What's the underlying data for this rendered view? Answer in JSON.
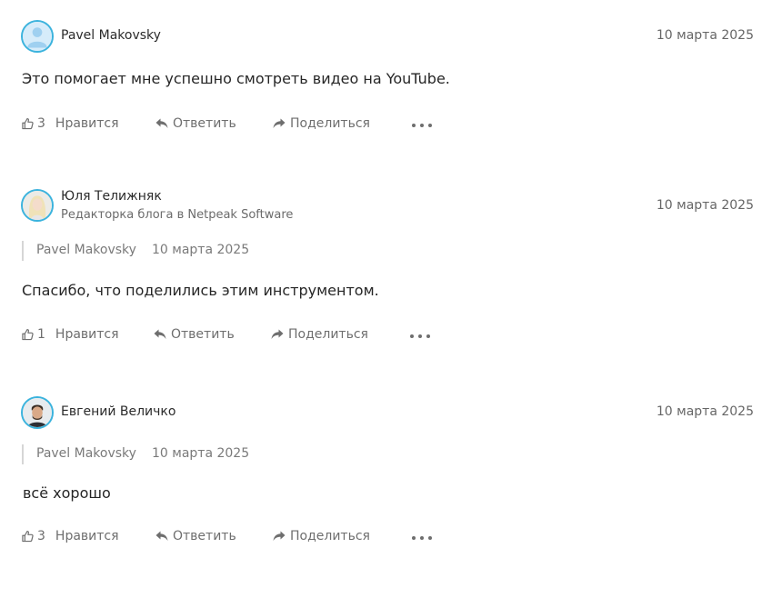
{
  "colors": {
    "accent": "#3bb3dd",
    "text": "#262626",
    "muted": "#6e6e6e"
  },
  "actions": {
    "like_label": "Нравится",
    "reply_label": "Ответить",
    "share_label": "Поделиться"
  },
  "comments": [
    {
      "author": "Pavel Makovsky",
      "role": "",
      "date": "10 марта 2025",
      "reply_to": null,
      "text": "Это помогает мне успешно смотреть видео на YouTube.",
      "likes": "3",
      "avatar_icon": "default-user-icon"
    },
    {
      "author": "Юля Телижняк",
      "role": "Редакторка блога в Netpeak Software",
      "date": "10 марта 2025",
      "reply_to": {
        "author": "Pavel Makovsky",
        "date": "10 марта 2025"
      },
      "text": "Спасибо, что поделились этим инструментом.",
      "likes": "1",
      "avatar_icon": "user-photo-icon"
    },
    {
      "author": "Евгений Величко",
      "role": "",
      "date": "10 марта 2025",
      "reply_to": {
        "author": "Pavel Makovsky",
        "date": "10 марта 2025"
      },
      "text": "всё хорошо",
      "likes": "3",
      "avatar_icon": "user-photo-icon"
    }
  ]
}
